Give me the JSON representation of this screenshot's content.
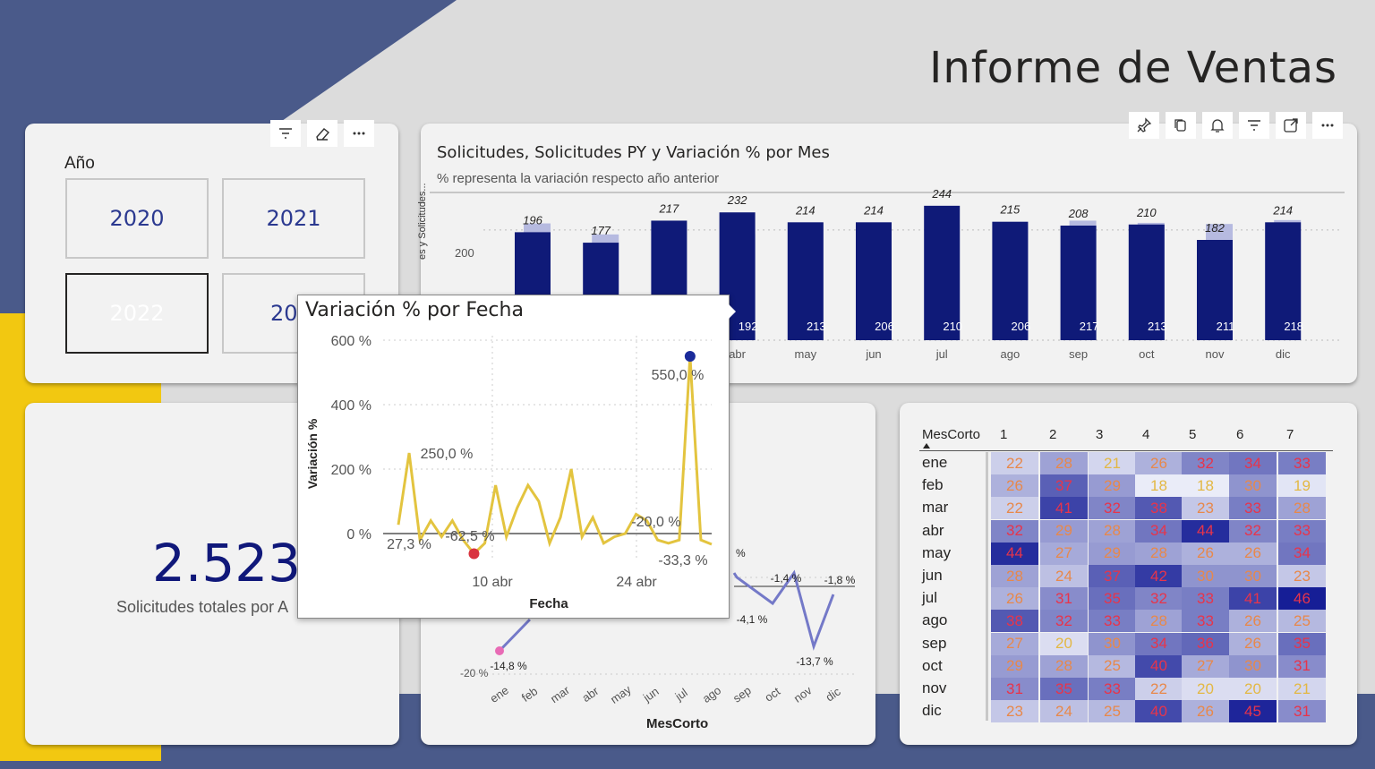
{
  "page": {
    "title": "Informe de Ventas",
    "colors": {
      "navy": "#4a5a8a",
      "accent_yellow": "#f2c811",
      "bar_dark": "#0f1a78",
      "bar_light": "#b6bae0",
      "line_yellow": "#e3c43f",
      "line_blue": "#7479c8"
    }
  },
  "slicer": {
    "title": "Año",
    "years": [
      "2020",
      "2021",
      "2022",
      "2023"
    ],
    "selected": "2022",
    "visible_partial_label": "20",
    "header_icons": [
      "filter-icon",
      "eraser-icon",
      "more-icon"
    ]
  },
  "kpi": {
    "value": "2.523",
    "label": "Solicitudes totales por A"
  },
  "bar_chart": {
    "title": "Solicitudes, Solicitudes PY y Variación % por Mes",
    "subtitle": "% representa la variación respecto año anterior",
    "ylabel_visible": "es y Solicitudes...",
    "ytick": "200",
    "header_icons": [
      "pin-icon",
      "copy-icon",
      "bell-icon",
      "filter-icon",
      "focus-icon",
      "more-icon"
    ]
  },
  "line_chart": {
    "xlabel": "MesCorto",
    "ytick": "-20 %"
  },
  "tooltip": {
    "title": "Variación % por Fecha",
    "ylabel": "Variación %",
    "xlabel": "Fecha",
    "yticks": [
      "600 %",
      "400 %",
      "200 %",
      "0 %"
    ],
    "xticks": [
      "10 abr",
      "24 abr"
    ],
    "annotations": [
      "250,0 %",
      "27,3 %",
      "-62,5 %",
      "550,0 %",
      "-20,0 %",
      "-33,3 %"
    ]
  },
  "matrix": {
    "row_header": "MesCorto",
    "columns": [
      "1",
      "2",
      "3",
      "4",
      "5",
      "6",
      "7"
    ],
    "rows": [
      "ene",
      "feb",
      "mar",
      "abr",
      "may",
      "jun",
      "jul",
      "ago",
      "sep",
      "oct",
      "nov",
      "dic"
    ],
    "values": [
      [
        22,
        28,
        21,
        26,
        32,
        34,
        33
      ],
      [
        26,
        37,
        29,
        18,
        18,
        30,
        19
      ],
      [
        22,
        41,
        32,
        38,
        23,
        33,
        28
      ],
      [
        32,
        29,
        28,
        34,
        44,
        32,
        33
      ],
      [
        44,
        27,
        29,
        28,
        26,
        26,
        34
      ],
      [
        28,
        24,
        37,
        42,
        30,
        30,
        23
      ],
      [
        26,
        31,
        35,
        32,
        33,
        41,
        46
      ],
      [
        38,
        32,
        33,
        28,
        33,
        26,
        25
      ],
      [
        27,
        20,
        30,
        34,
        36,
        26,
        35
      ],
      [
        29,
        28,
        25,
        40,
        27,
        30,
        31
      ],
      [
        31,
        35,
        33,
        22,
        20,
        20,
        21
      ],
      [
        23,
        24,
        25,
        40,
        26,
        45,
        31
      ]
    ]
  },
  "chart_data": [
    {
      "type": "bar",
      "title": "Solicitudes, Solicitudes PY y Variación % por Mes",
      "subtitle": "% representa la variación respecto año anterior",
      "categories": [
        "feb",
        "mar",
        "abr",
        "may",
        "jun",
        "jul",
        "ago",
        "sep",
        "oct",
        "nov",
        "dic"
      ],
      "tick_labels_visible": [
        "abr",
        "may",
        "jun",
        "jul",
        "ago",
        "sep",
        "oct",
        "nov",
        "dic"
      ],
      "series": [
        {
          "values": [
            196,
            177,
            217,
            232,
            214,
            214,
            244,
            215,
            208,
            210,
            182,
            214
          ],
          "categories_full": [
            "feb",
            "mar",
            "abr",
            "may",
            "jun",
            "jul",
            "ago",
            "sep",
            "oct",
            "nov",
            "dic"
          ]
        },
        {
          "values": [
            null,
            null,
            null,
            192,
            213,
            206,
            210,
            206,
            217,
            213,
            211,
            218
          ]
        }
      ],
      "current_labels": [
        "196",
        "177",
        "217",
        "232",
        "214",
        "214",
        "244",
        "215",
        "208",
        "210",
        "182",
        "214"
      ],
      "py_labels": [
        "192",
        "213",
        "206",
        "210",
        "206",
        "217",
        "213",
        "211",
        "218"
      ],
      "current": [
        196,
        177,
        217,
        232,
        214,
        214,
        244,
        215,
        208,
        210,
        182,
        214
      ],
      "py_estimate": [
        212,
        192,
        null,
        192,
        213,
        206,
        210,
        206,
        217,
        213,
        211,
        218
      ],
      "ylim": [
        0,
        260
      ],
      "grid": true
    },
    {
      "type": "line",
      "xlabel": "Fecha",
      "ylabel": "Variación %",
      "xticks": [
        "10 abr",
        "24 abr"
      ],
      "yticks": [
        "600 %",
        "400 %",
        "200 %",
        "0 %"
      ],
      "ylim": [
        -100,
        600
      ],
      "y": [
        27.3,
        250,
        -20,
        40,
        -10,
        40,
        -20,
        -62.5,
        -30,
        150,
        -10,
        80,
        150,
        100,
        -30,
        50,
        200,
        -10,
        50,
        -30,
        -10,
        0,
        60,
        40,
        -20,
        -30,
        -20,
        550,
        -20,
        -33.3
      ]
    },
    {
      "type": "line",
      "xlabel": "MesCorto",
      "categories": [
        "ene",
        "feb",
        "mar",
        "abr",
        "may",
        "jun",
        "jul",
        "ago",
        "sep",
        "oct",
        "nov",
        "dic"
      ],
      "visible_labels": [
        "-14,8 %",
        "-4,1 %",
        "-1,4 %",
        "-13,7 %",
        "-1,8 %"
      ],
      "y_visible": {
        "ene": -14.8,
        "ago": -4.1,
        "sep": -1.4,
        "nov": -13.7,
        "dic": -1.8
      },
      "ytick": "-20 %"
    },
    {
      "type": "heatmap",
      "rows": [
        "ene",
        "feb",
        "mar",
        "abr",
        "may",
        "jun",
        "jul",
        "ago",
        "sep",
        "oct",
        "nov",
        "dic"
      ],
      "columns": [
        "1",
        "2",
        "3",
        "4",
        "5",
        "6",
        "7"
      ]
    }
  ]
}
